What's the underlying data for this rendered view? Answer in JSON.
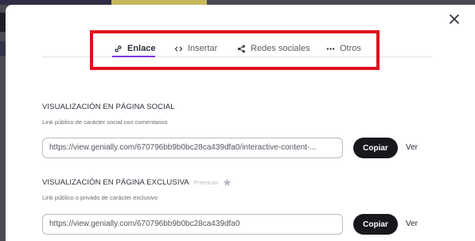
{
  "tabs": [
    {
      "label": "Enlace",
      "icon": "link-icon",
      "active": true
    },
    {
      "label": "Insertar",
      "icon": "code-icon",
      "active": false
    },
    {
      "label": "Redes sociales",
      "icon": "share-icon",
      "active": false
    },
    {
      "label": "Otros",
      "icon": "more-horizontal-icon",
      "active": false
    }
  ],
  "social_section": {
    "title": "VISUALIZACIÓN EN PÁGINA SOCIAL",
    "subtitle": "Link público de carácter social con comentarios",
    "url": "https://view.genially.com/670796bb9b0bc28ca439dfa0/interactive-content-...",
    "copy_label": "Copiar",
    "view_label": "Ver"
  },
  "exclusive_section": {
    "title": "VISUALIZACIÓN EN PÁGINA EXCLUSIVA",
    "premium_label": "Premium",
    "subtitle": "Link público o privado de carácter exclusivo",
    "url": "https://view.genially.com/670796bb9b0bc28ca439dfa0",
    "copy_label": "Copiar",
    "view_label": "Ver"
  },
  "colors": {
    "accent": "#7a39e0",
    "highlight": "#e0101f",
    "button": "#17171c"
  }
}
